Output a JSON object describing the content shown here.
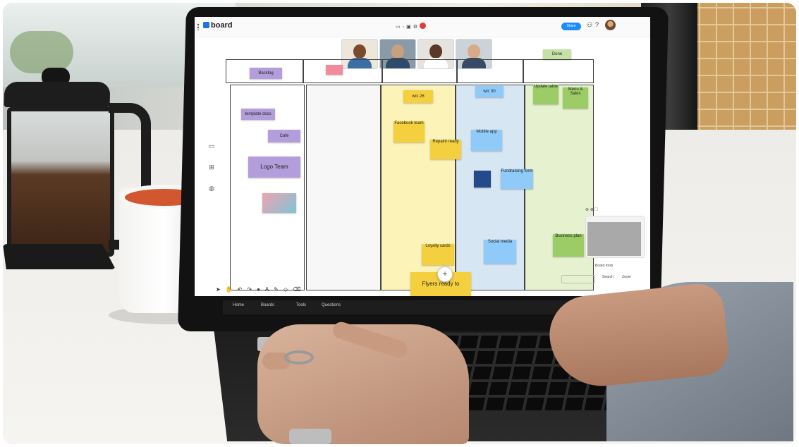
{
  "app": {
    "brand": "board",
    "share_label": "Share"
  },
  "columns": [
    {
      "header": "Backlog"
    },
    {
      "header": ""
    },
    {
      "header": "w/c 26"
    },
    {
      "header": "w/c 30"
    },
    {
      "header": "Done"
    }
  ],
  "notes": {
    "backlog": "Backlog",
    "template": "template docs",
    "cafe": "Cafe",
    "logo_team": "Logo Team",
    "w26": "w/c 26",
    "w30": "w/c 30",
    "done": "Done",
    "facebook": "Facebook team",
    "repaint": "Repaint ready",
    "mobile": "Mobile app",
    "fundraising": "Fundraising form",
    "loyalty": "Loyalty cards",
    "social": "Social media",
    "business": "Business plan",
    "flyers": "Flyers ready to",
    "done1": "Update table",
    "done2": "Menu & Sales"
  },
  "footer": {
    "home": "Home",
    "boards": "Boards",
    "tools": "Tools",
    "questions": "Questions"
  },
  "bottom_right": {
    "search": "Search",
    "board_tools": "Board tools",
    "zoom": "Zoom"
  },
  "colors": {
    "purple_note": "#b39ddb",
    "yellow_note": "#f4d03f",
    "blue_note": "#90caf9",
    "green_note": "#c5e1a5",
    "accent": "#1a8cff",
    "end_call": "#e53935"
  }
}
